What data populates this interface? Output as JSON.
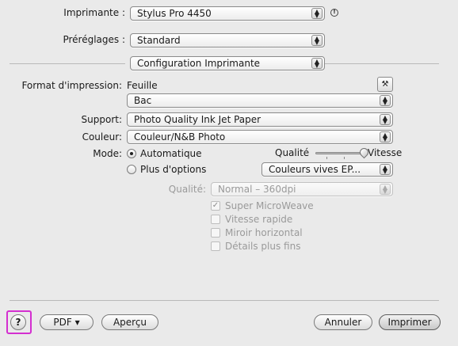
{
  "printer": {
    "label": "Imprimante :",
    "value": "Stylus Pro 4450",
    "status_icon": "info-circle"
  },
  "presets": {
    "label": "Préréglages :",
    "value": "Standard"
  },
  "panel": {
    "value": "Configuration Imprimante"
  },
  "format": {
    "label": "Format d'impression:",
    "value": "Feuille",
    "tray_value": "Bac",
    "icon": "print-utility"
  },
  "support": {
    "label": "Support:",
    "value": "Photo Quality Ink Jet Paper"
  },
  "color": {
    "label": "Couleur:",
    "value": "Couleur/N&B Photo"
  },
  "mode": {
    "label": "Mode:",
    "automatic_label": "Automatique",
    "advanced_label": "Plus d'options",
    "selected": "automatic",
    "slider_left_label": "Qualité",
    "slider_right_label": "Vitesse",
    "slider_level": 1.0,
    "color_preset": "Couleurs vives EP..."
  },
  "quality": {
    "label": "Qualité:",
    "value": "Normal – 360dpi"
  },
  "options": [
    {
      "label": "Super MicroWeave",
      "checked": true
    },
    {
      "label": "Vitesse rapide",
      "checked": false
    },
    {
      "label": "Miroir horizontal",
      "checked": false
    },
    {
      "label": "Détails plus fins",
      "checked": false
    }
  ],
  "footer": {
    "help_label": "?",
    "pdf_label": "PDF ▾",
    "preview_label": "Aperçu",
    "cancel_label": "Annuler",
    "print_label": "Imprimer"
  },
  "colors": {
    "highlight": "#d42fd0"
  }
}
